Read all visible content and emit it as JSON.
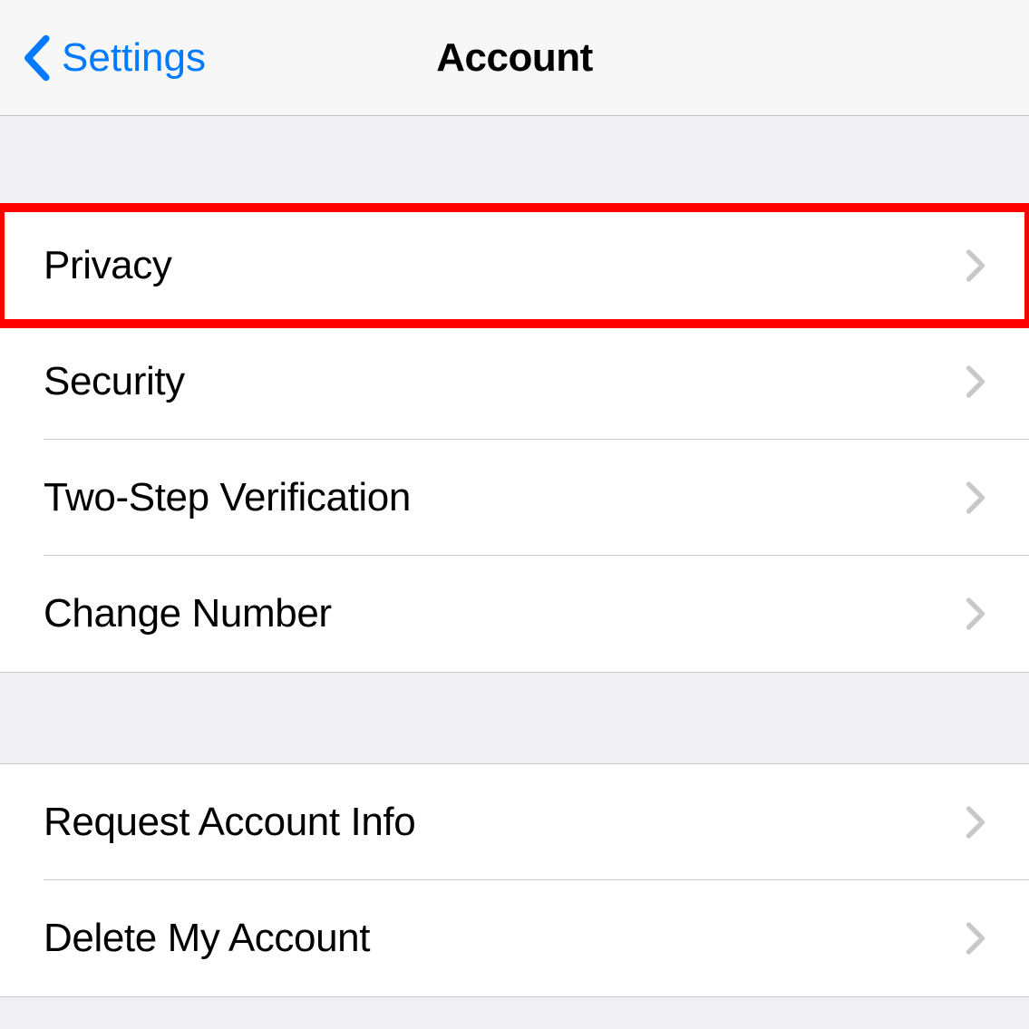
{
  "navbar": {
    "back_label": "Settings",
    "title": "Account"
  },
  "sections": [
    {
      "items": [
        {
          "label": "Privacy",
          "highlighted": true
        },
        {
          "label": "Security",
          "highlighted": false
        },
        {
          "label": "Two-Step Verification",
          "highlighted": false
        },
        {
          "label": "Change Number",
          "highlighted": false
        }
      ]
    },
    {
      "items": [
        {
          "label": "Request Account Info",
          "highlighted": false
        },
        {
          "label": "Delete My Account",
          "highlighted": false
        }
      ]
    }
  ]
}
